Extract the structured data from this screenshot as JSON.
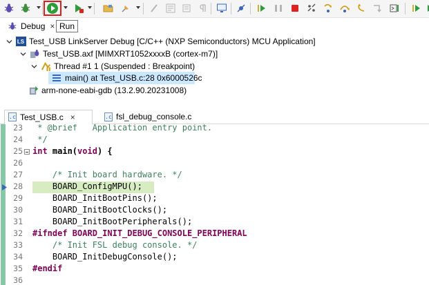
{
  "toolbar": {
    "icons": [
      "debug-icon",
      "settings-bug-icon",
      "resume-icon",
      "run-icon",
      "stop-icon",
      "open-folder-icon",
      "pin-icon",
      "step-icon",
      "view-icon",
      "restore-icon",
      "terminate-icon",
      "disconnect-icon",
      "step-into-icon",
      "step-over-icon",
      "step-return-icon",
      "instruction-step-icon",
      "perspective-icon"
    ]
  },
  "views": {
    "debug_label": "Debug",
    "run_label": "Run"
  },
  "tree": {
    "launch": "Test_USB LinkServer Debug [C/C++ (NXP Semiconductors) MCU Application]",
    "launch_badge": "LS",
    "target": "Test_USB.axf [MIMXRT1052xxxxB (cortex-m7)]",
    "thread": "Thread #1 1 (Suspended : Breakpoint)",
    "frame": "main() at Test_USB.c:28 0x6000526c",
    "gdb": "arm-none-eabi-gdb (13.2.90.20231008)"
  },
  "editor_tabs": [
    {
      "label": "Test_USB.c",
      "active": true,
      "close": "×"
    },
    {
      "label": "fsl_debug_console.c",
      "active": false
    }
  ],
  "file_icon_label": ".c",
  "code_lines": [
    {
      "n": "23",
      "text": " * @brief   Application entry point.",
      "kind": "cm"
    },
    {
      "n": "24",
      "text": " */",
      "kind": "cm"
    },
    {
      "n": "25",
      "text": "int main(void) {",
      "kind": "fn"
    },
    {
      "n": "26",
      "text": "",
      "kind": "plain"
    },
    {
      "n": "27",
      "text": "    /* Init board hardware. */",
      "kind": "cm"
    },
    {
      "n": "28",
      "text": "    BOARD_ConfigMPU();",
      "kind": "plain"
    },
    {
      "n": "29",
      "text": "    BOARD_InitBootPins();",
      "kind": "plain"
    },
    {
      "n": "30",
      "text": "    BOARD_InitBootClocks();",
      "kind": "plain"
    },
    {
      "n": "31",
      "text": "    BOARD_InitBootPeripherals();",
      "kind": "plain"
    },
    {
      "n": "32",
      "text": "#ifndef BOARD_INIT_DEBUG_CONSOLE_PERIPHERAL",
      "kind": "pp"
    },
    {
      "n": "33",
      "text": "    /* Init FSL debug console. */",
      "kind": "cm"
    },
    {
      "n": "34",
      "text": "    BOARD_InitDebugConsole();",
      "kind": "plain"
    },
    {
      "n": "35",
      "text": "#endif",
      "kind": "pp"
    },
    {
      "n": "36",
      "text": "",
      "kind": "plain"
    }
  ],
  "colors": {
    "resume_green": "#2e9c3a",
    "highlight_red": "#e01b1b",
    "current_line": "#d7ecc0",
    "selection": "#cce8ff",
    "keyword": "#7f0055",
    "comment": "#3f7f5f"
  }
}
